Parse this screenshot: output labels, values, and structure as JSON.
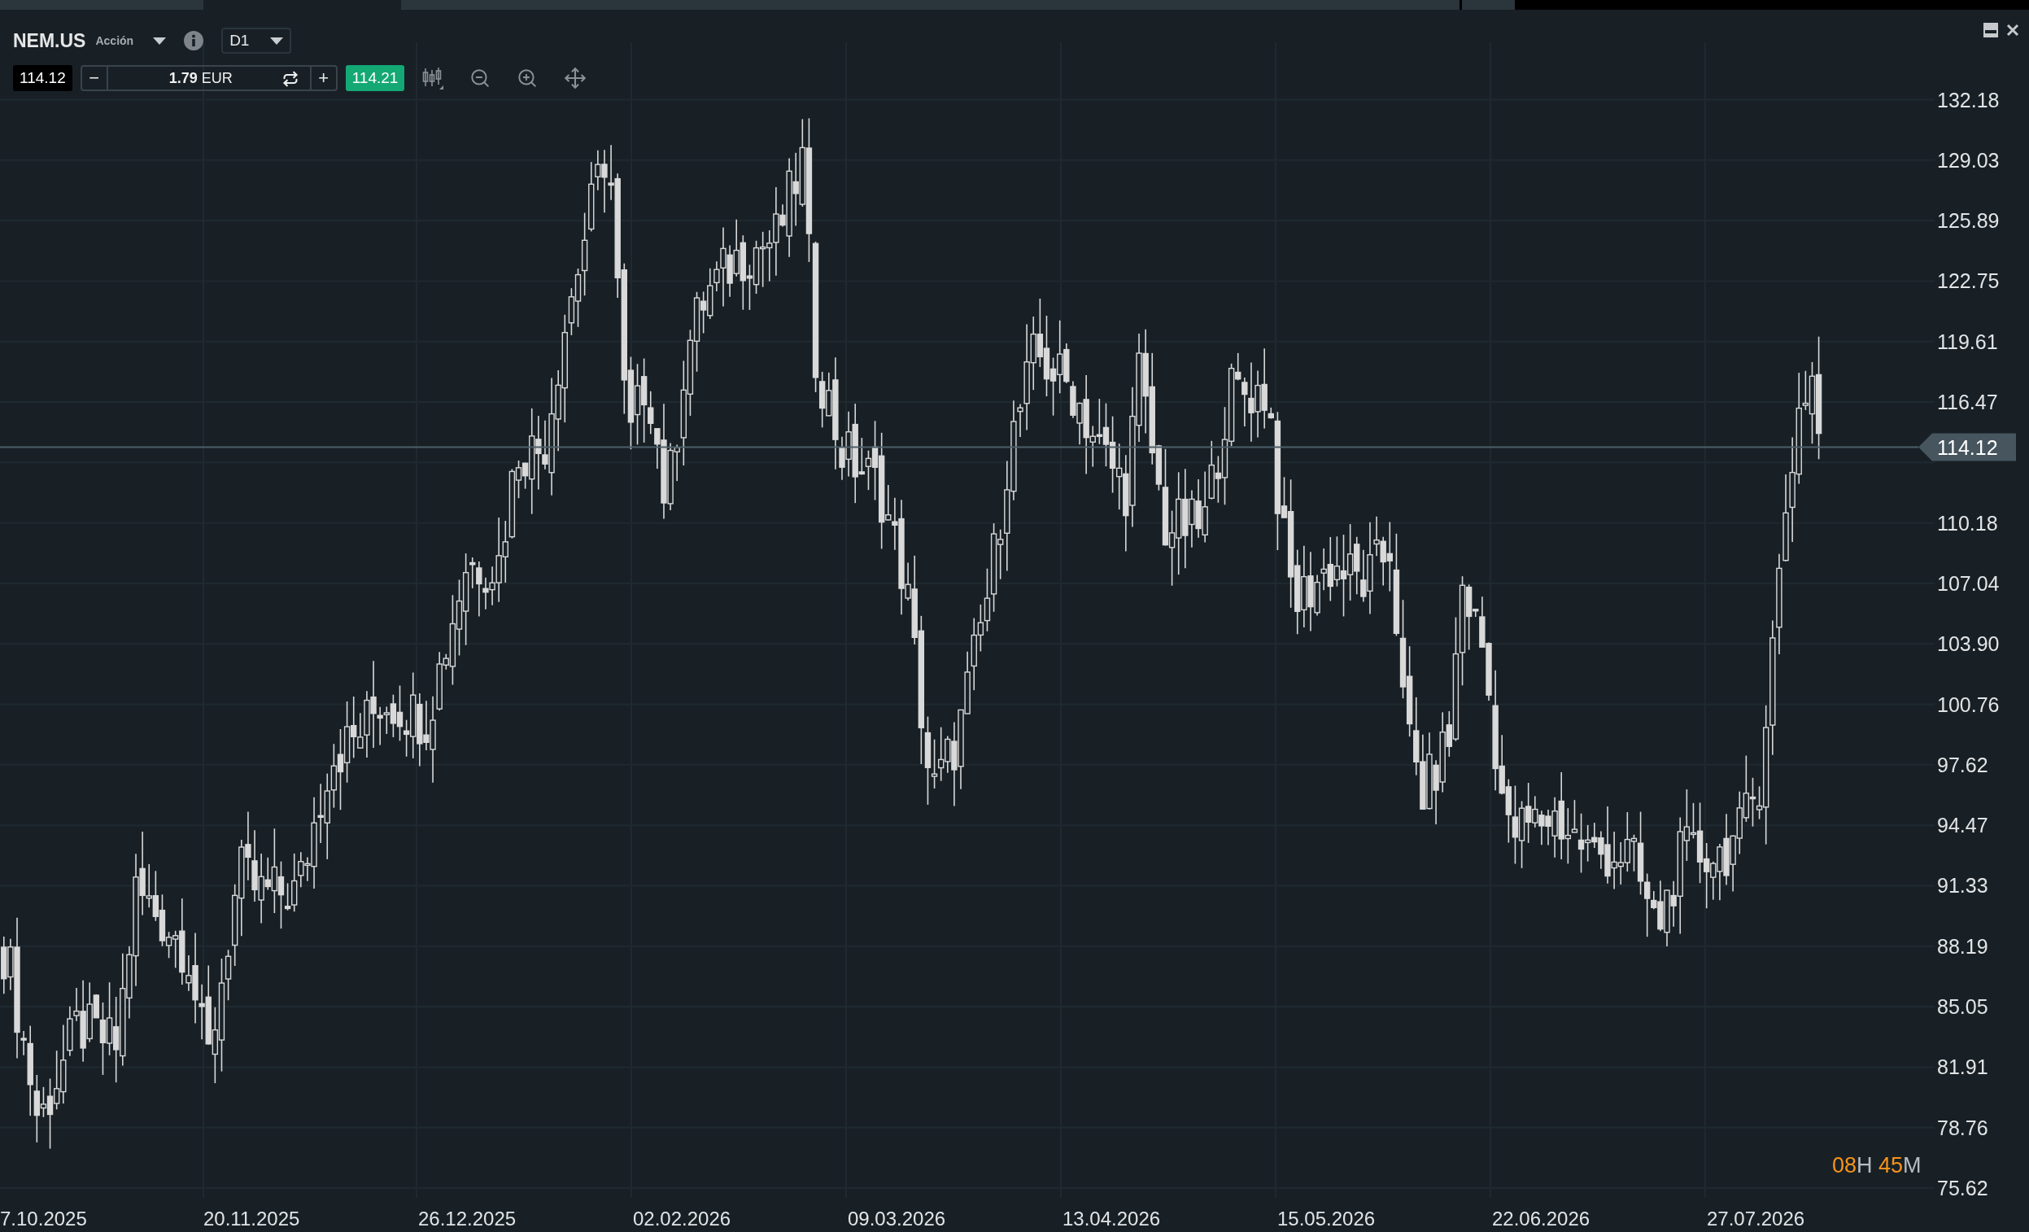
{
  "instrument": {
    "symbol": "NEM.US",
    "type": "Acción"
  },
  "timeframe": {
    "value": "D1"
  },
  "trade": {
    "sell_price": "114.12",
    "minus": "−",
    "quantity": "**1.79** EUR",
    "plus": "+",
    "buy_price": "114.21"
  },
  "chart": {
    "price_ticks": [
      "132.18",
      "129.03",
      "125.89",
      "122.75",
      "119.61",
      "116.47",
      "110.18",
      "107.04",
      "103.90",
      "100.76",
      "97.62",
      "94.47",
      "91.33",
      "88.19",
      "85.05",
      "81.91",
      "78.76",
      "75.62"
    ],
    "date_ticks": [
      "7.10.2025",
      "20.11.2025",
      "26.12.2025",
      "02.02.2026",
      "09.03.2026",
      "13.04.2026",
      "15.05.2026",
      "22.06.2026",
      "27.07.2026"
    ],
    "current_price": "114.12",
    "countdown": {
      "hours": "08",
      "hours_unit": "H",
      "minutes": "45",
      "minutes_unit": "M"
    }
  }
}
